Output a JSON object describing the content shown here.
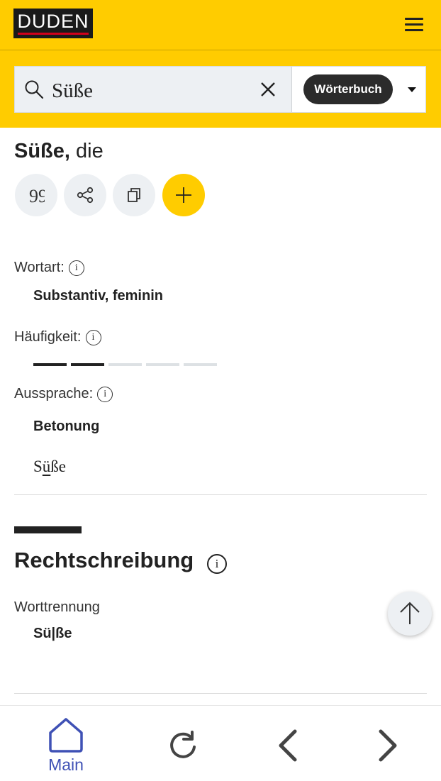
{
  "header": {
    "logo_text": "DUDEN",
    "menu_icon": "hamburger-menu-icon"
  },
  "search": {
    "query": "Süße",
    "placeholder": "",
    "search_icon": "search-icon",
    "clear_icon": "close-icon",
    "dictionary_label": "Wörterbuch",
    "dropdown_icon": "caret-down-icon"
  },
  "entry": {
    "headword": "Süße,",
    "article": "die",
    "actions": [
      {
        "icon": "quote-icon"
      },
      {
        "icon": "share-icon"
      },
      {
        "icon": "copy-icon"
      },
      {
        "icon": "plus-icon"
      }
    ],
    "wortart_label": "Wortart:",
    "wortart_value": "Substantiv, feminin",
    "haeufigkeit_label": "Häufigkeit:",
    "haeufigkeit_level": 2,
    "haeufigkeit_max": 5,
    "aussprache_label": "Aussprache:",
    "betonung_label": "Betonung",
    "pron_before": "S",
    "pron_stressed": "ü",
    "pron_after": "ße",
    "info_glyph": "i"
  },
  "section": {
    "title": "Rechtschreibung",
    "worttrennung_label": "Worttrennung",
    "worttrennung_value": "Sü|ße"
  },
  "bottom_nav": {
    "main_label": "Main",
    "items": [
      "home-icon",
      "reload-icon",
      "back-arrow-icon",
      "forward-arrow-icon"
    ]
  },
  "colors": {
    "brand_yellow": "#ffcc00",
    "accent_blue": "#3f51b5",
    "dark": "#222222"
  }
}
